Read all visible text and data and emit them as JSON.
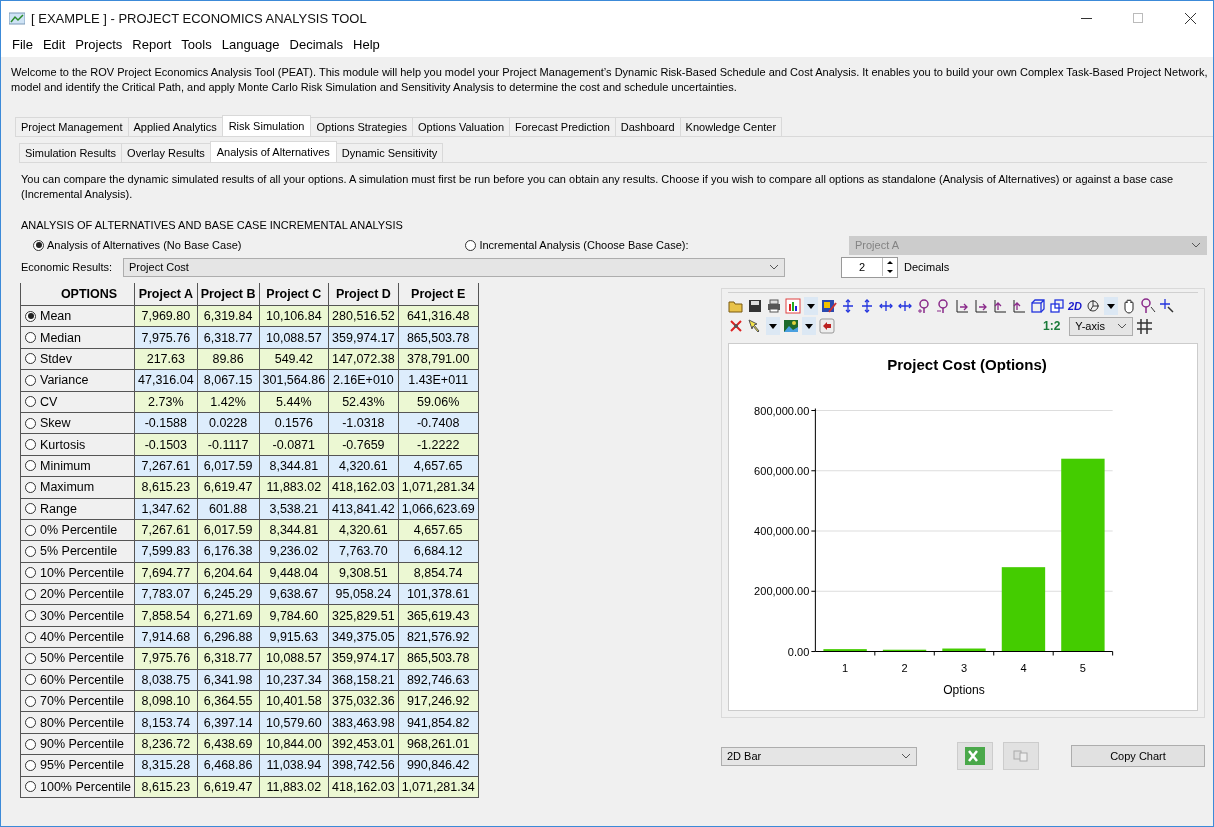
{
  "window": {
    "title": "[ EXAMPLE ] - PROJECT ECONOMICS ANALYSIS TOOL"
  },
  "menu": [
    "File",
    "Edit",
    "Projects",
    "Report",
    "Tools",
    "Language",
    "Decimals",
    "Help"
  ],
  "intro": "Welcome to the ROV Project Economics Analysis Tool (PEAT). This module will help you model your Project Management’s Dynamic Risk-Based Schedule and Cost Analysis. It enables you to build your own Complex Task-Based Project Network, model and identify the Critical Path, and apply Monte Carlo Risk Simulation and Sensitivity Analysis to determine the cost and schedule uncertainties.",
  "tabs": [
    {
      "label": "Project Management",
      "selected": false
    },
    {
      "label": "Applied Analytics",
      "selected": false
    },
    {
      "label": "Risk Simulation",
      "selected": true
    },
    {
      "label": "Options Strategies",
      "selected": false
    },
    {
      "label": "Options Valuation",
      "selected": false
    },
    {
      "label": "Forecast Prediction",
      "selected": false
    },
    {
      "label": "Dashboard",
      "selected": false
    },
    {
      "label": "Knowledge Center",
      "selected": false
    }
  ],
  "subtabs": [
    {
      "label": "Simulation Results",
      "selected": false
    },
    {
      "label": "Overlay Results",
      "selected": false
    },
    {
      "label": "Analysis of Alternatives",
      "selected": true
    },
    {
      "label": "Dynamic Sensitivity",
      "selected": false
    }
  ],
  "description": "You can compare the dynamic simulated results of all your options. A simulation must first be run before you can obtain any results. Choose if you wish to compare all options as standalone (Analysis of Alternatives) or against a base case (Incremental Analysis).",
  "section_title": "ANALYSIS OF ALTERNATIVES AND BASE CASE INCREMENTAL ANALYSIS",
  "mode_options": [
    {
      "label": "Analysis of Alternatives (No Base Case)",
      "selected": true
    },
    {
      "label": "Incremental Analysis (Choose Base Case):",
      "selected": false
    }
  ],
  "base_case": {
    "value": "Project A",
    "disabled": true
  },
  "economic_results": {
    "label": "Economic Results:",
    "value": "Project Cost"
  },
  "decimals": {
    "value": "2",
    "label": "Decimals"
  },
  "table": {
    "columns": [
      "OPTIONS",
      "Project A",
      "Project B",
      "Project C",
      "Project D",
      "Project E"
    ],
    "rows": [
      {
        "selected": true,
        "cells": [
          "Mean",
          "7,969.80",
          "6,319.84",
          "10,106.84",
          "280,516.52",
          "641,316.48"
        ]
      },
      {
        "selected": false,
        "cells": [
          "Median",
          "7,975.76",
          "6,318.77",
          "10,088.57",
          "359,974.17",
          "865,503.78"
        ]
      },
      {
        "selected": false,
        "cells": [
          "Stdev",
          "217.63",
          "89.86",
          "549.42",
          "147,072.38",
          "378,791.00"
        ]
      },
      {
        "selected": false,
        "cells": [
          "Variance",
          "47,316.04",
          "8,067.15",
          "301,564.86",
          "2.16E+010",
          "1.43E+011"
        ]
      },
      {
        "selected": false,
        "cells": [
          "CV",
          "2.73%",
          "1.42%",
          "5.44%",
          "52.43%",
          "59.06%"
        ]
      },
      {
        "selected": false,
        "cells": [
          "Skew",
          "-0.1588",
          "0.0228",
          "0.1576",
          "-1.0318",
          "-0.7408"
        ]
      },
      {
        "selected": false,
        "cells": [
          "Kurtosis",
          "-0.1503",
          "-0.1117",
          "-0.0871",
          "-0.7659",
          "-1.2222"
        ]
      },
      {
        "selected": false,
        "cells": [
          "Minimum",
          "7,267.61",
          "6,017.59",
          "8,344.81",
          "4,320.61",
          "4,657.65"
        ]
      },
      {
        "selected": false,
        "cells": [
          "Maximum",
          "8,615.23",
          "6,619.47",
          "11,883.02",
          "418,162.03",
          "1,071,281.34"
        ]
      },
      {
        "selected": false,
        "cells": [
          "Range",
          "1,347.62",
          "601.88",
          "3,538.21",
          "413,841.42",
          "1,066,623.69"
        ]
      },
      {
        "selected": false,
        "cells": [
          "0% Percentile",
          "7,267.61",
          "6,017.59",
          "8,344.81",
          "4,320.61",
          "4,657.65"
        ]
      },
      {
        "selected": false,
        "cells": [
          "5% Percentile",
          "7,599.83",
          "6,176.38",
          "9,236.02",
          "7,763.70",
          "6,684.12"
        ]
      },
      {
        "selected": false,
        "cells": [
          "10% Percentile",
          "7,694.77",
          "6,204.64",
          "9,448.04",
          "9,308.51",
          "8,854.74"
        ]
      },
      {
        "selected": false,
        "cells": [
          "20% Percentile",
          "7,783.07",
          "6,245.29",
          "9,638.67",
          "95,058.24",
          "101,378.61"
        ]
      },
      {
        "selected": false,
        "cells": [
          "30% Percentile",
          "7,858.54",
          "6,271.69",
          "9,784.60",
          "325,829.51",
          "365,619.43"
        ]
      },
      {
        "selected": false,
        "cells": [
          "40% Percentile",
          "7,914.68",
          "6,296.88",
          "9,915.63",
          "349,375.05",
          "821,576.92"
        ]
      },
      {
        "selected": false,
        "cells": [
          "50% Percentile",
          "7,975.76",
          "6,318.77",
          "10,088.57",
          "359,974.17",
          "865,503.78"
        ]
      },
      {
        "selected": false,
        "cells": [
          "60% Percentile",
          "8,038.75",
          "6,341.98",
          "10,237.34",
          "368,158.21",
          "892,746.63"
        ]
      },
      {
        "selected": false,
        "cells": [
          "70% Percentile",
          "8,098.10",
          "6,364.55",
          "10,401.58",
          "375,032.36",
          "917,246.92"
        ]
      },
      {
        "selected": false,
        "cells": [
          "80% Percentile",
          "8,153.74",
          "6,397.14",
          "10,579.60",
          "383,463.98",
          "941,854.82"
        ]
      },
      {
        "selected": false,
        "cells": [
          "90% Percentile",
          "8,236.72",
          "6,438.69",
          "10,844.00",
          "392,453.01",
          "968,261.01"
        ]
      },
      {
        "selected": false,
        "cells": [
          "95% Percentile",
          "8,315.28",
          "6,468.86",
          "11,038.94",
          "398,742.56",
          "990,846.42"
        ]
      },
      {
        "selected": false,
        "cells": [
          "100% Percentile",
          "8,615.23",
          "6,619.47",
          "11,883.02",
          "418,162.03",
          "1,071,281.34"
        ]
      }
    ]
  },
  "chart_panel": {
    "mode_label": "2D",
    "ratio_label": "1:2",
    "axis_select": "Y-axis",
    "chart_data": {
      "type": "bar",
      "title": "Project Cost (Options)",
      "xlabel": "Options",
      "categories": [
        "1",
        "2",
        "3",
        "4",
        "5"
      ],
      "series": [
        {
          "color": "#44cc00",
          "values": [
            8000,
            6000,
            10000,
            280000,
            640000
          ]
        }
      ],
      "grid": true,
      "ylim": [
        0,
        800000
      ],
      "yticks": [
        {
          "value": 0,
          "label": "0.00"
        },
        {
          "value": 200000,
          "label": "200,000.00"
        },
        {
          "value": 400000,
          "label": "400,000.00"
        },
        {
          "value": 600000,
          "label": "600,000.00"
        },
        {
          "value": 800000,
          "label": "800,000.00"
        }
      ]
    }
  },
  "chart_type": "2D Bar",
  "copy_button": "Copy Chart"
}
